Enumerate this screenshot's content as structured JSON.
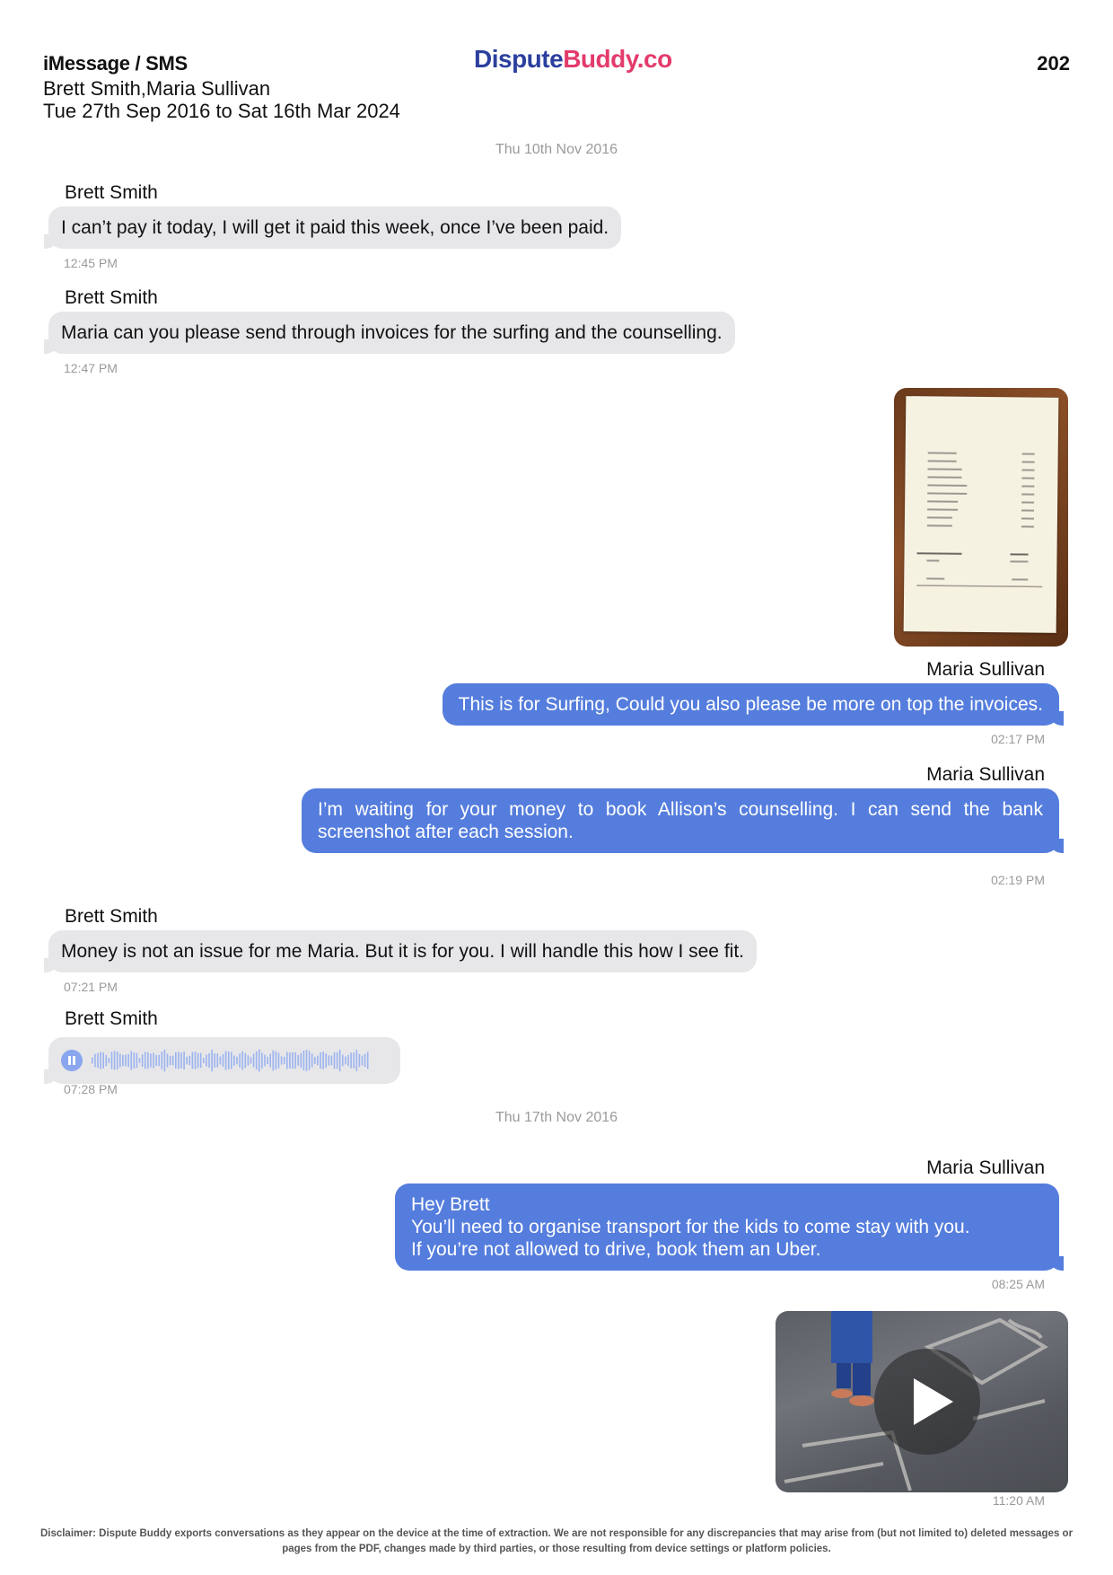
{
  "header": {
    "title": "iMessage / SMS",
    "participants": "Brett Smith,Maria Sullivan",
    "date_range": "Tue 27th Sep 2016 to Sat 16th Mar 2024",
    "logo_part1": "Dispute",
    "logo_part2": "Buddy.co",
    "page_number": "202"
  },
  "colors": {
    "incoming_bubble": "#e7e7ea",
    "outgoing_bubble": "#557ddd",
    "logo_blue": "#2b3f9e",
    "logo_pink": "#e33b6b"
  },
  "date_separators": [
    "Thu 10th Nov 2016",
    "Thu 17th Nov 2016"
  ],
  "messages": [
    {
      "sender": "Brett Smith",
      "text": "I can’t pay it today, I will get it paid this week, once I’ve been paid.",
      "time": "12:45 PM"
    },
    {
      "sender": "Brett Smith",
      "text": "Maria can you please send through invoices for the surfing and the counselling.",
      "time": "12:47 PM"
    },
    {
      "sender": "Maria Sullivan",
      "attachment": "receipt-photo"
    },
    {
      "sender": "Maria Sullivan",
      "text": "This is for Surfing,  Could you also please be more on top the invoices.",
      "time": "02:17 PM"
    },
    {
      "sender": "Maria Sullivan",
      "text": "I’m waiting for your money to book Allison’s counselling. I can send the bank screenshot after each session.",
      "time": "02:19 PM"
    },
    {
      "sender": "Brett Smith",
      "text": "Money is not an issue for me Maria. But it is for you. I will handle this how I see fit.",
      "time": "07:21 PM"
    },
    {
      "sender": "Brett Smith",
      "attachment": "audio-message",
      "time": "07:28 PM"
    },
    {
      "sender": "Maria Sullivan",
      "lines": [
        "Hey Brett",
        "You’ll need to organise transport for the kids to come stay with you.",
        "If you’re not allowed to drive, book them an Uber."
      ],
      "time": "08:25 AM"
    },
    {
      "sender": "Maria Sullivan",
      "attachment": "video",
      "time": "11:20 AM"
    }
  ],
  "disclaimer": "Disclaimer: Dispute Buddy exports conversations as they appear on the device at the time of extraction. We are not responsible for any discrepancies that may arise from (but not limited to) deleted messages or pages from the PDF, changes made by third parties, or those resulting from device settings or platform policies."
}
